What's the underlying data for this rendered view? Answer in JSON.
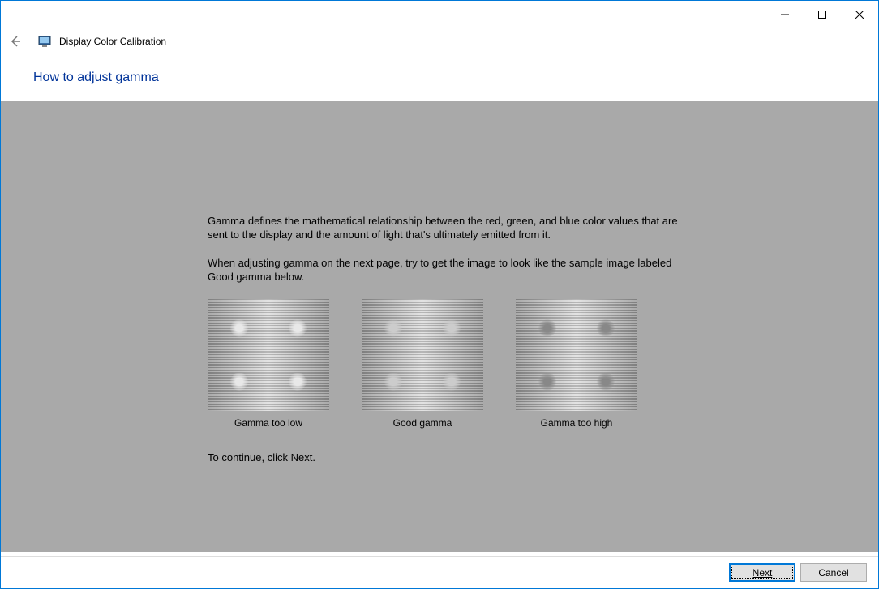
{
  "window": {
    "app_title": "Display Color Calibration"
  },
  "heading": "How to adjust gamma",
  "paragraphs": {
    "p1": "Gamma defines the mathematical relationship between the red, green, and blue color values that are sent to the display and the amount of light that's ultimately emitted from it.",
    "p2": "When adjusting gamma on the next page, try to get the image to look like the sample image labeled Good gamma below.",
    "continue": "To continue, click Next."
  },
  "samples": {
    "low": "Gamma too low",
    "good": "Good gamma",
    "high": "Gamma too high"
  },
  "buttons": {
    "next": "Next",
    "cancel": "Cancel"
  }
}
